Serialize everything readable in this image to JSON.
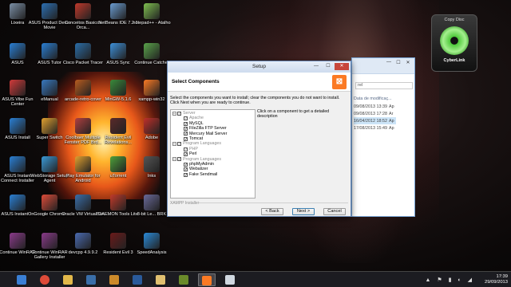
{
  "desktop": {
    "icons": [
      {
        "label": "Lixeira",
        "color": "#7b8fa6"
      },
      {
        "label": "ASUS Product Demo Movie",
        "color": "#2c6fb3"
      },
      {
        "label": "Conceitos Basicos Orca...",
        "color": "#c0392b"
      },
      {
        "label": "NetBeans IDE 7.2.1",
        "color": "#6a9bd1"
      },
      {
        "label": "notepad++ - Atalho",
        "color": "#7fbf4f"
      },
      {
        "label": "ASUS",
        "color": "#2a7fd4"
      },
      {
        "label": "ASUS Tutor",
        "color": "#2a7fd4"
      },
      {
        "label": "Cisco Packet Tracer",
        "color": "#2b6ea8"
      },
      {
        "label": "ASUS Sync",
        "color": "#3d8fd8"
      },
      {
        "label": "Continue Catcher",
        "color": "#5aa34a"
      },
      {
        "label": "ASUS Vibe Fun Center",
        "color": "#d23a3a"
      },
      {
        "label": "eManual",
        "color": "#3878c0"
      },
      {
        "label": "arcade-retro-cover",
        "color": "#b85c1f"
      },
      {
        "label": "MinGW-5.1.6",
        "color": "#3a8a3a"
      },
      {
        "label": "xampp-win32",
        "color": "#fb7a24"
      },
      {
        "label": "ASUS Install",
        "color": "#2a7fd4"
      },
      {
        "label": "Super Switch",
        "color": "#e0a030"
      },
      {
        "label": "Coolbaer Multiple Fenster PDF Brd...",
        "color": "#b04040"
      },
      {
        "label": "Resident Evil Revelations...",
        "color": "#5a2a2a"
      },
      {
        "label": "Adobe",
        "color": "#c0302a"
      },
      {
        "label": "ASUS Instant Connect Installer",
        "color": "#2a7fd4"
      },
      {
        "label": "WebStorage Setup Agent",
        "color": "#3a9ad8"
      },
      {
        "label": "Play Emulator for Android",
        "color": "#e0a030"
      },
      {
        "label": "uTorrent",
        "color": "#4ea03a"
      },
      {
        "label": "Inks",
        "color": "#555555"
      },
      {
        "label": "ASUS InstantOn",
        "color": "#2a7fd4"
      },
      {
        "label": "Google Chrome",
        "color": "#dd4b39"
      },
      {
        "label": "Oracle VM VirtualBox",
        "color": "#3a6ea8"
      },
      {
        "label": "DAEMON Tools Lite",
        "color": "#c23a2a"
      },
      {
        "label": "8-bit Le... BRK",
        "color": "#6a6a9a"
      },
      {
        "label": "Continue WinRAR",
        "color": "#8a3a8a"
      },
      {
        "label": "Continue WinRAR Gallery Installer",
        "color": "#8a3a8a"
      },
      {
        "label": "devcpp 4.9.9.2",
        "color": "#4a6ab0"
      },
      {
        "label": "Resident Evil 3",
        "color": "#6a1a1a"
      },
      {
        "label": "SpeedAnalysis",
        "color": "#2a8ad8"
      }
    ]
  },
  "gadget": {
    "title": "Copy Disc",
    "brand": "CyberLink"
  },
  "explorer": {
    "search_text": "rel",
    "column_header": "Data de modificaç...",
    "rows": [
      {
        "date": "09/08/2013 13:39",
        "type": "Ap"
      },
      {
        "date": "09/08/2013 17:28",
        "type": "Ar"
      },
      {
        "date": "16/04/2012 18:52",
        "type": "Ap"
      },
      {
        "date": "17/08/2013 15:49",
        "type": "Ap"
      }
    ],
    "minimize": "—",
    "maximize": "☐",
    "close": "✕"
  },
  "setup": {
    "title": "Setup",
    "header": "Select Components",
    "logo": "⊠",
    "description": "Select the components you want to install; clear the components you do not want to install. Click Next when you are ready to continue.",
    "hint": "Click on a component to get a detailed description",
    "footer_label": "XAMPP Installer",
    "buttons": {
      "back": "< Back",
      "next": "Next >",
      "cancel": "Cancel"
    },
    "title_controls": {
      "minimize": "—",
      "maximize": "☐",
      "close": "✕"
    },
    "tree": [
      {
        "label": "Server",
        "kind": "group",
        "disabled": true
      },
      {
        "label": "Apache",
        "kind": "child",
        "disabled": true
      },
      {
        "label": "MySQL",
        "kind": "child",
        "disabled": false
      },
      {
        "label": "FileZilla FTP Server",
        "kind": "child",
        "disabled": false
      },
      {
        "label": "Mercury Mail Server",
        "kind": "child",
        "disabled": false
      },
      {
        "label": "Tomcat",
        "kind": "child",
        "disabled": false
      },
      {
        "label": "Program Languages",
        "kind": "group",
        "disabled": true
      },
      {
        "label": "PHP",
        "kind": "child",
        "disabled": true
      },
      {
        "label": "Perl",
        "kind": "child",
        "disabled": false
      },
      {
        "label": "Program Languages",
        "kind": "group",
        "disabled": true
      },
      {
        "label": "phpMyAdmin",
        "kind": "child",
        "disabled": false
      },
      {
        "label": "Webalizer",
        "kind": "child",
        "disabled": false
      },
      {
        "label": "Fake Sendmail",
        "kind": "child",
        "disabled": false
      }
    ]
  },
  "taskbar": {
    "items": [
      {
        "name": "file-explorer",
        "color": "#3a7fd4"
      },
      {
        "name": "chrome",
        "color": "#dd4b39"
      },
      {
        "name": "folder",
        "color": "#e2b84a"
      },
      {
        "name": "virtualbox",
        "color": "#3a6ea8"
      },
      {
        "name": "media",
        "color": "#cc8a2a"
      },
      {
        "name": "word",
        "color": "#2a5a9a"
      },
      {
        "name": "notes",
        "color": "#e0c070"
      },
      {
        "name": "game",
        "color": "#6a8a2a"
      },
      {
        "name": "xampp",
        "color": "#fb7a24"
      },
      {
        "name": "explorer-window",
        "color": "#d0d8e0"
      }
    ],
    "active_index": 8,
    "tray_symbols": "▲ ⚑ ▮ ◐ ◢",
    "time": "17:39",
    "date": "29/09/2013"
  }
}
